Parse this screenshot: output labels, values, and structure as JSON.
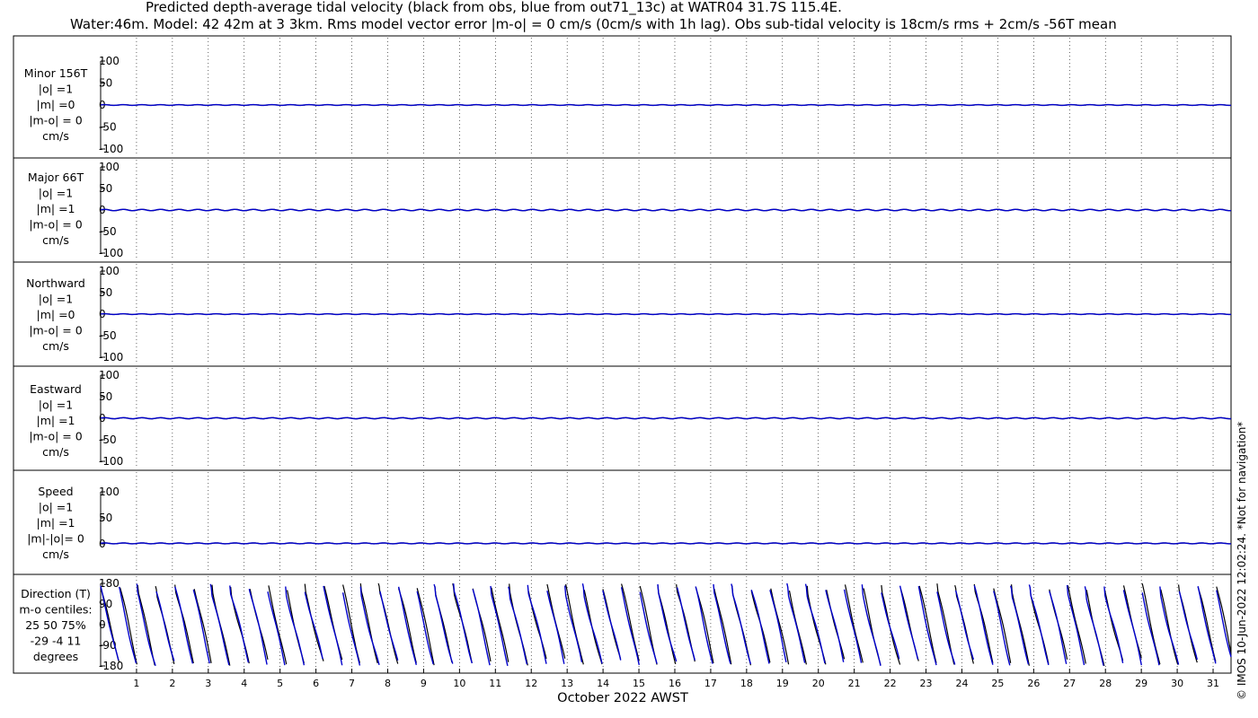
{
  "figure": {
    "title_line1": "Predicted depth-average tidal velocity (black from obs, blue from out71_13c) at WATR04 31.7S 115.4E.",
    "title_line2": "Water:46m. Model: 42 42m at 3 3km. Rms model vector error |m-o| = 0 cm/s (0cm/s with 1h lag). Obs sub-tidal velocity is 18cm/s rms + 2cm/s -56T mean",
    "xlabel": "October 2022 AWST",
    "credit": "© IMOS 10-Jun-2022 12:02:24. *Not for navigation*"
  },
  "colors": {
    "obs": "#000000",
    "model": "#0000cc",
    "frame": "#000000"
  },
  "chart_data": [
    {
      "type": "line",
      "name": "minor",
      "label": [
        "Minor 156T",
        "|o| =1",
        "|m| =0",
        "|m-o| = 0",
        "cm/s"
      ],
      "ylim": [
        -100,
        100
      ],
      "yticks": [
        100,
        50,
        0,
        -50,
        -100
      ],
      "xlim": [
        0,
        31.5
      ],
      "grid": true,
      "series": [
        {
          "color": "#000000",
          "mean": 0,
          "amplitude": 0.8
        },
        {
          "color": "#0000cc",
          "mean": 0,
          "amplitude": 0.8
        }
      ]
    },
    {
      "type": "line",
      "name": "major",
      "label": [
        "Major 66T",
        "|o| =1",
        "|m| =1",
        "|m-o| = 0",
        "cm/s"
      ],
      "ylim": [
        -100,
        100
      ],
      "yticks": [
        100,
        50,
        0,
        -50,
        -100
      ],
      "xlim": [
        0,
        31.5
      ],
      "grid": true,
      "series": [
        {
          "color": "#000000",
          "mean": 0,
          "amplitude": 1.5
        },
        {
          "color": "#0000cc",
          "mean": 0,
          "amplitude": 1.5
        }
      ]
    },
    {
      "type": "line",
      "name": "northward",
      "label": [
        "Northward",
        "|o| =1",
        "|m| =0",
        "|m-o| = 0",
        "cm/s"
      ],
      "ylim": [
        -100,
        100
      ],
      "yticks": [
        100,
        50,
        0,
        -50,
        -100
      ],
      "xlim": [
        0,
        31.5
      ],
      "grid": true,
      "series": [
        {
          "color": "#000000",
          "mean": 0,
          "amplitude": 0.8
        },
        {
          "color": "#0000cc",
          "mean": 0,
          "amplitude": 0.8
        }
      ]
    },
    {
      "type": "line",
      "name": "eastward",
      "label": [
        "Eastward",
        "|o| =1",
        "|m| =1",
        "|m-o| = 0",
        "cm/s"
      ],
      "ylim": [
        -100,
        100
      ],
      "yticks": [
        100,
        50,
        0,
        -50,
        -100
      ],
      "xlim": [
        0,
        31.5
      ],
      "grid": true,
      "series": [
        {
          "color": "#000000",
          "mean": 0,
          "amplitude": 1.2
        },
        {
          "color": "#0000cc",
          "mean": 0,
          "amplitude": 1.2
        }
      ]
    },
    {
      "type": "line",
      "name": "speed",
      "label": [
        "Speed",
        "|o| =1",
        "|m| =1",
        "|m|-|o|= 0",
        "cm/s"
      ],
      "ylim": [
        -5,
        110
      ],
      "yticks": [
        100,
        50,
        0
      ],
      "xlim": [
        0,
        31.5
      ],
      "grid": true,
      "series": [
        {
          "color": "#000000",
          "mean": 1,
          "amplitude": 0.8
        },
        {
          "color": "#0000cc",
          "mean": 1,
          "amplitude": 0.8
        }
      ]
    },
    {
      "type": "line",
      "name": "direction",
      "label": [
        "Direction (T)",
        "m-o centiles:",
        "25  50  75%",
        "-29  -4  11",
        "degrees"
      ],
      "ylim": [
        -180,
        180
      ],
      "yticks": [
        180,
        90,
        0,
        -90,
        -180
      ],
      "xlim": [
        0,
        31.5
      ],
      "grid": true,
      "cycles_per_day": 1.93,
      "wrap_deg": 360,
      "series": [
        {
          "color": "#000000",
          "start_deg": 160,
          "slope_deg_per_cycle": 340
        },
        {
          "color": "#0000cc",
          "start_deg": 150,
          "slope_deg_per_cycle": 335
        }
      ]
    }
  ],
  "x_ticks": [
    "1",
    "2",
    "3",
    "4",
    "5",
    "6",
    "7",
    "8",
    "9",
    "10",
    "11",
    "12",
    "13",
    "14",
    "15",
    "16",
    "17",
    "18",
    "19",
    "20",
    "21",
    "22",
    "23",
    "24",
    "25",
    "26",
    "27",
    "28",
    "29",
    "30",
    "31"
  ]
}
